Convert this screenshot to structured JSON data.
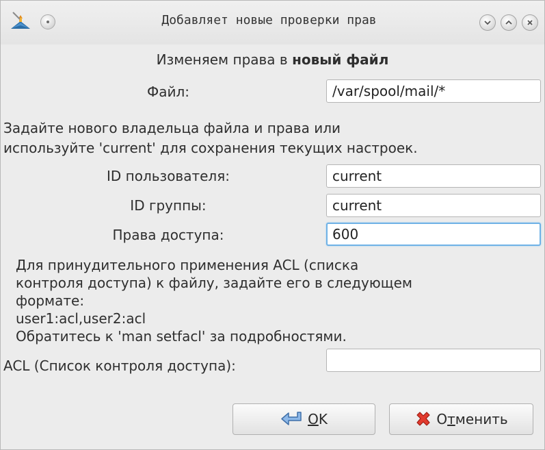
{
  "window": {
    "title": "Добавляет новые проверки прав"
  },
  "form": {
    "heading_prefix": "Изменяем права в",
    "heading_bold": "новый файл",
    "file_label": "Файл:",
    "file_value": "/var/spool/mail/*",
    "owner_hint_line1": "Задайте нового владельца файла и права или",
    "owner_hint_line2": "используйте 'current' для сохранения текущих настроек.",
    "uid_label": "ID пользователя:",
    "uid_value": "current",
    "gid_label": "ID группы:",
    "gid_value": "current",
    "perm_label": "Права доступа:",
    "perm_value": "600",
    "acl_hint": [
      "Для принудительного применения ACL (списка",
      "контроля доступа) к файлу, задайте его в следующем",
      "формате:",
      "user1:acl,user2:acl",
      "Обратитесь к 'man setfacl' за подробностями."
    ],
    "acl_label": "ACL (Список контроля доступа):",
    "acl_value": ""
  },
  "buttons": {
    "ok_mnemonic": "O",
    "ok_rest": "K",
    "cancel_first": "О",
    "cancel_mnemonic": "т",
    "cancel_rest": "менить"
  },
  "icons": {
    "app": "drakconf-hat-icon",
    "menu": "window-menu-icon",
    "minimize": "chevron-down-icon",
    "maximize": "chevron-up-icon",
    "close": "close-icon",
    "ok": "enter-arrow-icon",
    "cancel": "red-x-icon"
  }
}
